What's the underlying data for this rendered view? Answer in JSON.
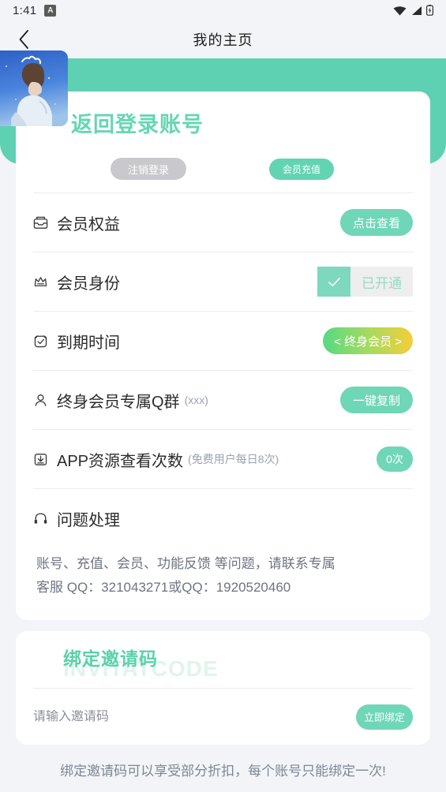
{
  "status_bar": {
    "time": "1:41",
    "app_badge": "A",
    "icons": [
      "wifi-icon",
      "signal-icon",
      "battery-icon"
    ]
  },
  "nav": {
    "back_icon": "chevron-left-icon",
    "title": "我的主页"
  },
  "profile": {
    "username": "返回登录账号",
    "avatar_alt": "anime-profile-avatar",
    "logout_label": "注销登录",
    "recharge_label": "会员充值"
  },
  "rows": [
    {
      "icon": "inbox-icon",
      "label": "会员权益",
      "sub": "",
      "action_label": "点击查看"
    },
    {
      "icon": "crown-icon",
      "label": "会员身份",
      "sub": "",
      "badge_label": "已开通",
      "badge_check": "check-icon"
    },
    {
      "icon": "alarm-clock-icon",
      "label": "到期时间",
      "sub": "",
      "action_label": "< 终身会员 >"
    },
    {
      "icon": "user-icon",
      "label": "终身会员专属Q群",
      "sub": "(xxx)",
      "action_label": "一键复制"
    },
    {
      "icon": "download-icon",
      "label": "APP资源查看次数",
      "sub": "(免费用户每日8次)",
      "action_label": "0次"
    },
    {
      "icon": "headphones-icon",
      "label": "问题处理",
      "sub": "",
      "action_label": ""
    }
  ],
  "support": {
    "line1": "账号、充值、会员、功能反馈 等问题，请联系专属",
    "line2": "客服 QQ：321043271或QQ：1920520460"
  },
  "invite": {
    "title": "绑定邀请码",
    "watermark": "INVITATCODE",
    "placeholder": "请输入邀请码",
    "input_value": "",
    "bind_label": "立即绑定"
  },
  "footer": {
    "note": "绑定邀请码可以享受部分折扣，每个账号只能绑定一次!"
  },
  "colors": {
    "brand_green": "#5ed1b3",
    "button_green": "#6fd6b7",
    "gradient_start": "#57d983",
    "gradient_end": "#f6cd3a",
    "page_bg": "#f2f4f8",
    "gray_button": "#c9c9cd"
  }
}
